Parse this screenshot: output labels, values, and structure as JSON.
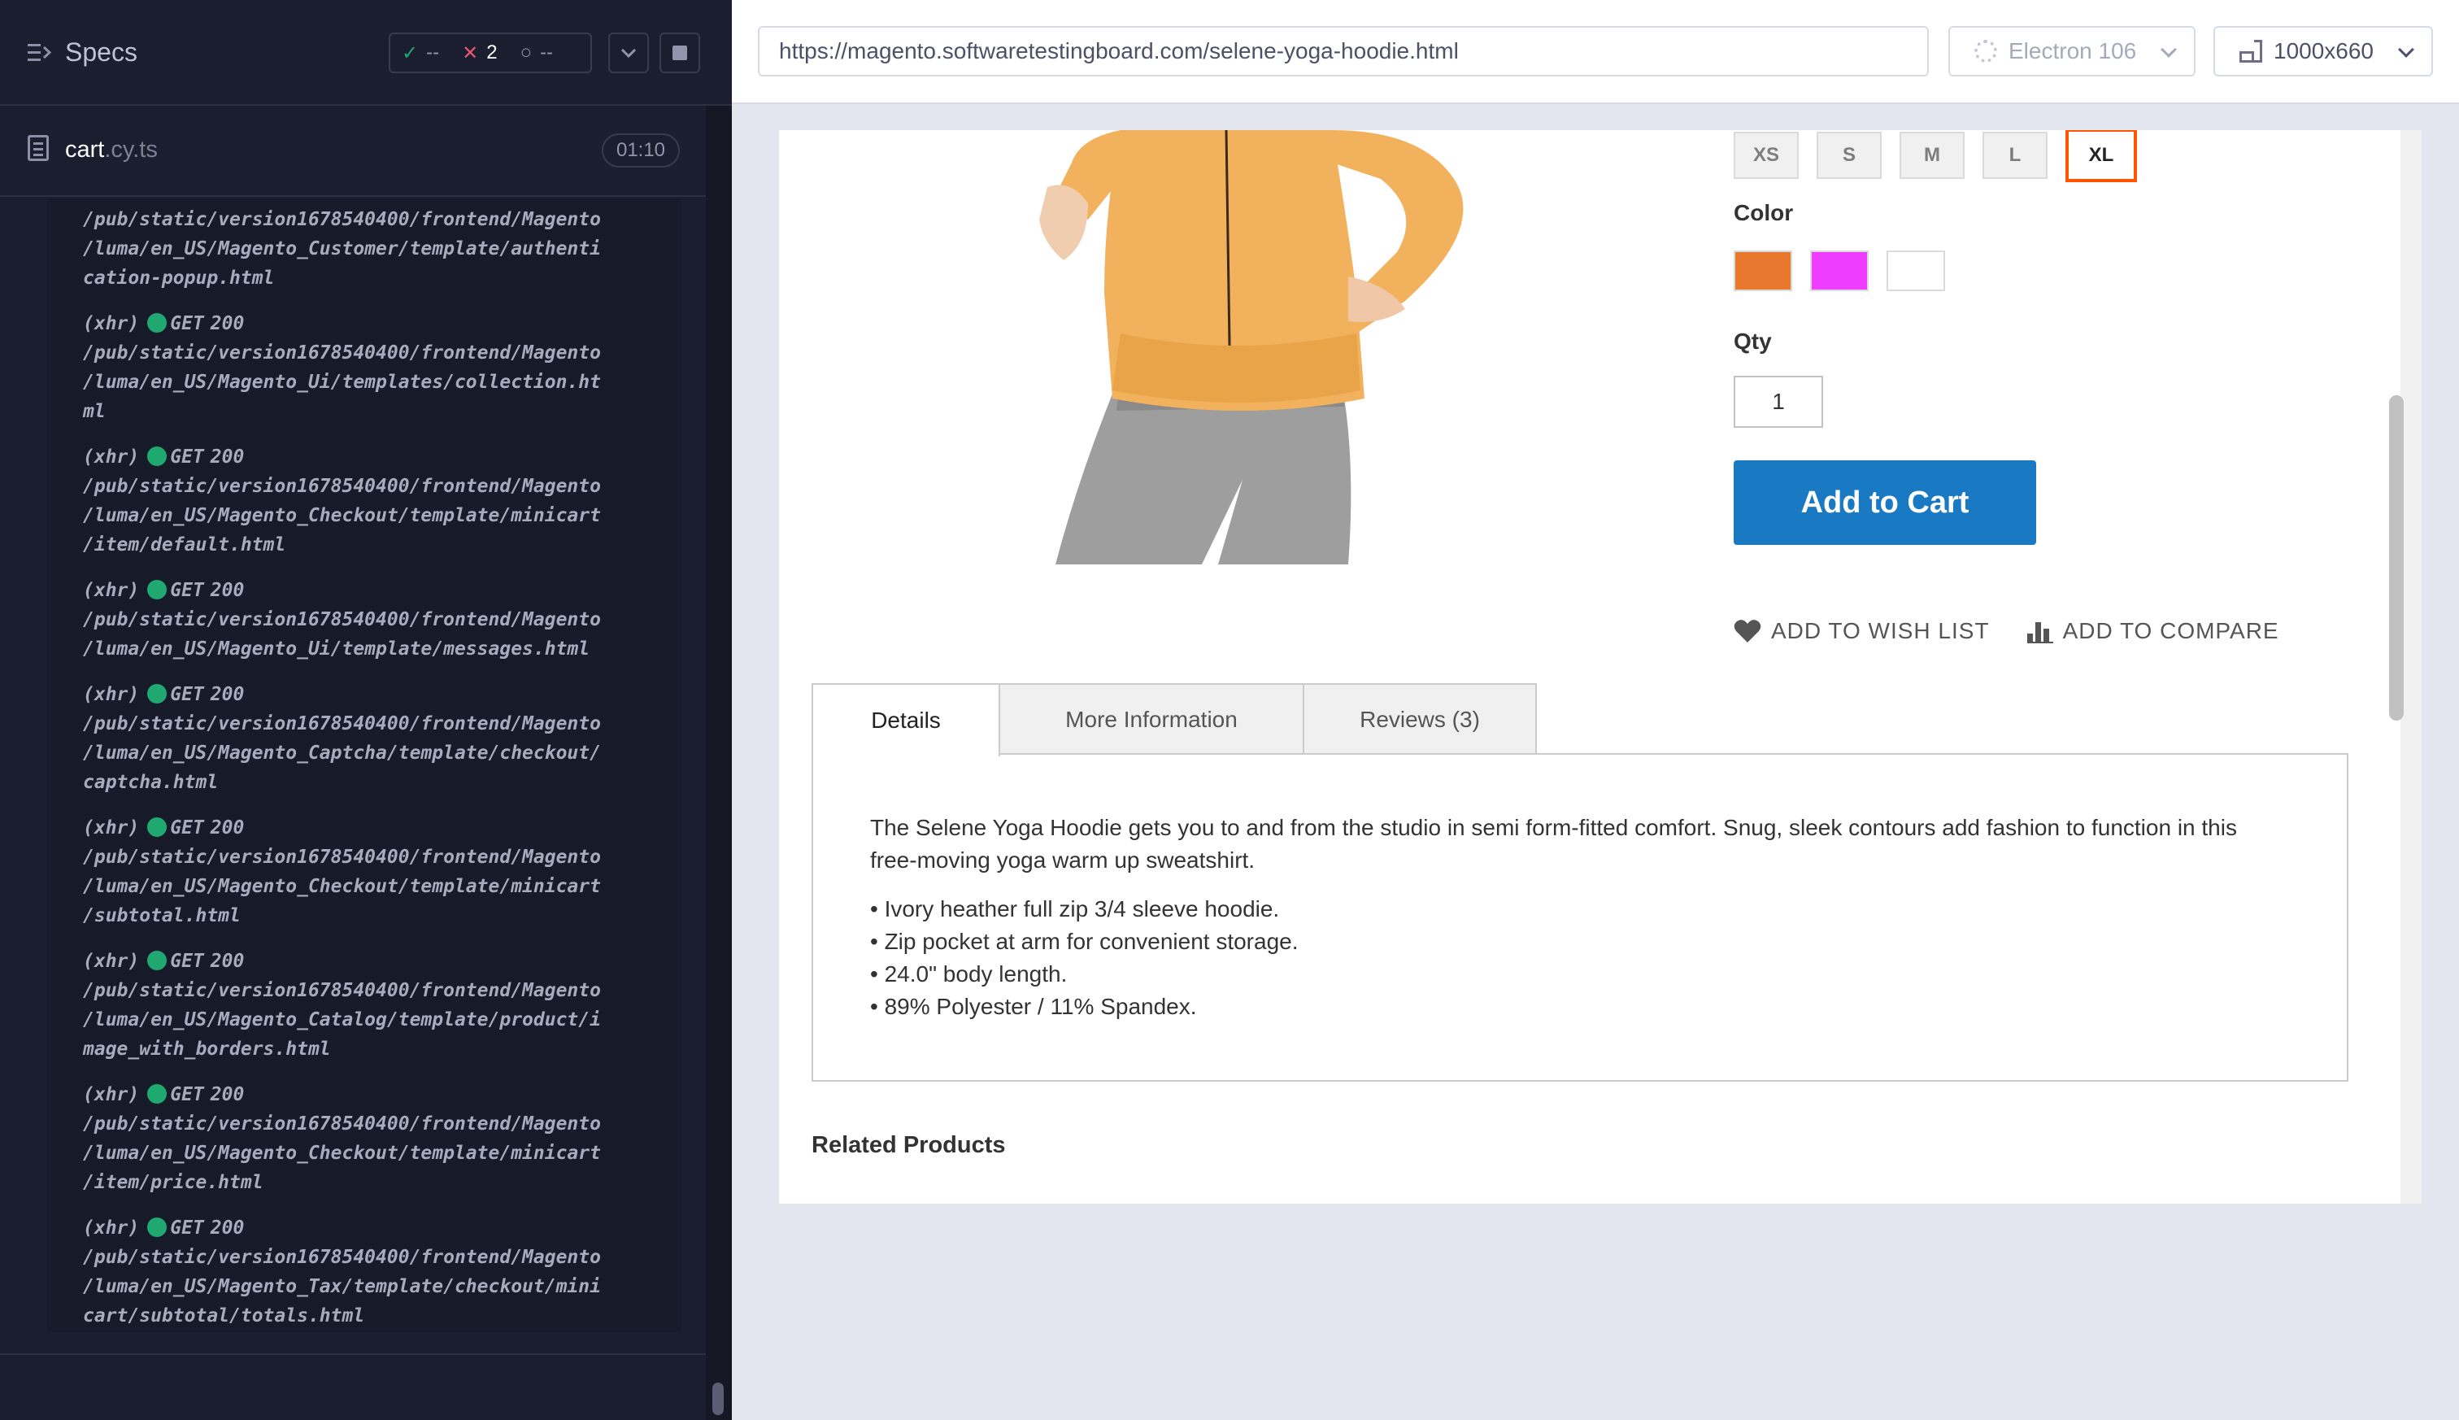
{
  "runner": {
    "specs_title": "Specs",
    "stats": {
      "passed": "--",
      "failed": "2",
      "pending": "--"
    },
    "spec_file": {
      "name": "cart",
      "ext": ".cy.ts",
      "duration": "01:10"
    },
    "log_lines": [
      {
        "text": "/pub/static/version1678540400/frontend/Magento",
        "y": 0
      },
      {
        "text": "/luma/en_US/Magento_Customer/template/authenti",
        "y": 1
      },
      {
        "text": "cation-popup.html",
        "y": 2
      }
    ],
    "requests": [
      {
        "type": "(xhr)",
        "method": "GET",
        "status": "200",
        "path": [
          "/pub/static/version1678540400/frontend/Magento",
          "/luma/en_US/Magento_Ui/templates/collection.ht",
          "ml"
        ]
      },
      {
        "type": "(xhr)",
        "method": "GET",
        "status": "200",
        "path": [
          "/pub/static/version1678540400/frontend/Magento",
          "/luma/en_US/Magento_Checkout/template/minicart",
          "/item/default.html"
        ]
      },
      {
        "type": "(xhr)",
        "method": "GET",
        "status": "200",
        "path": [
          "/pub/static/version1678540400/frontend/Magento",
          "/luma/en_US/Magento_Ui/template/messages.html"
        ]
      },
      {
        "type": "(xhr)",
        "method": "GET",
        "status": "200",
        "path": [
          "/pub/static/version1678540400/frontend/Magento",
          "/luma/en_US/Magento_Captcha/template/checkout/",
          "captcha.html"
        ]
      },
      {
        "type": "(xhr)",
        "method": "GET",
        "status": "200",
        "path": [
          "/pub/static/version1678540400/frontend/Magento",
          "/luma/en_US/Magento_Checkout/template/minicart",
          "/subtotal.html"
        ]
      },
      {
        "type": "(xhr)",
        "method": "GET",
        "status": "200",
        "path": [
          "/pub/static/version1678540400/frontend/Magento",
          "/luma/en_US/Magento_Catalog/template/product/i",
          "mage_with_borders.html"
        ]
      },
      {
        "type": "(xhr)",
        "method": "GET",
        "status": "200",
        "path": [
          "/pub/static/version1678540400/frontend/Magento",
          "/luma/en_US/Magento_Checkout/template/minicart",
          "/item/price.html"
        ]
      },
      {
        "type": "(xhr)",
        "method": "GET",
        "status": "200",
        "path": [
          "/pub/static/version1678540400/frontend/Magento",
          "/luma/en_US/Magento_Tax/template/checkout/mini",
          "cart/subtotal/totals.html"
        ]
      }
    ]
  },
  "toolbar": {
    "url": "https://magento.softwaretestingboard.com/selene-yoga-hoodie.html",
    "browser": "Electron 106",
    "viewport": "1000x660"
  },
  "product": {
    "sizes": [
      "XS",
      "S",
      "M",
      "L",
      "XL"
    ],
    "selected_size": "XL",
    "color_label": "Color",
    "colors": [
      "#e8782e",
      "#ef3dff",
      "#ffffff"
    ],
    "qty_label": "Qty",
    "qty_value": "1",
    "add_to_cart": "Add to Cart",
    "wish_list": "ADD TO WISH LIST",
    "compare": "ADD TO COMPARE",
    "tabs": [
      "Details",
      "More Information",
      "Reviews (3)"
    ],
    "active_tab": "Details",
    "description": "The Selene Yoga Hoodie gets you to and from the studio in semi form-fitted comfort. Snug, sleek contours add fashion to function in this free-moving yoga warm up sweatshirt.",
    "bullets": [
      "• Ivory heather full zip 3/4 sleeve hoodie.",
      "• Zip pocket at arm for convenient storage.",
      "• 24.0\" body length.",
      "• 89% Polyester / 11% Spandex."
    ],
    "related_title": "Related Products"
  }
}
